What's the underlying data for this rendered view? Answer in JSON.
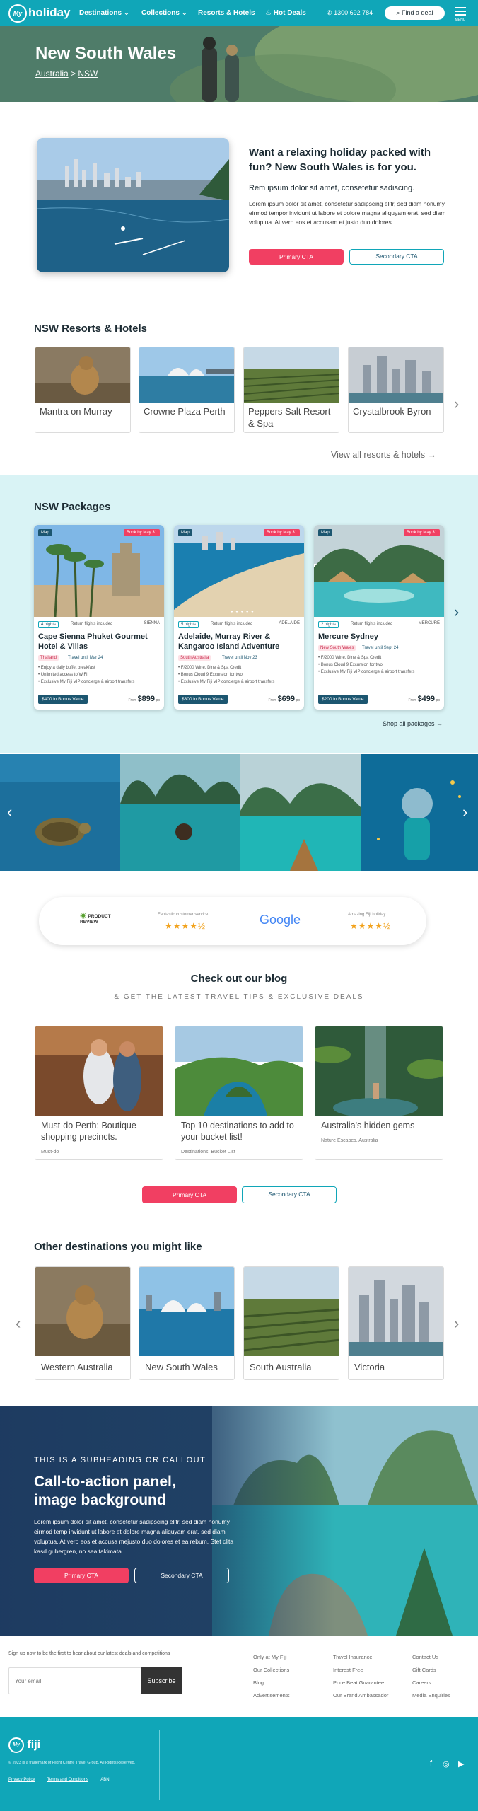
{
  "header": {
    "logo": "holiday",
    "logo_mark": "My",
    "nav": [
      "Destinations",
      "Collections",
      "Resorts & Hotels",
      "Hot Deals"
    ],
    "phone": "1300 692 784",
    "find_deal": "Find a deal",
    "menu_label": "MENU"
  },
  "hero": {
    "title": "New South Wales",
    "breadcrumb_parent": "Australia",
    "breadcrumb_sep": ">",
    "breadcrumb_current": "NSW"
  },
  "intro": {
    "heading": "Want a relaxing holiday packed with fun? New South Wales is for you.",
    "subheading": "Rem ipsum dolor sit amet, consetetur sadiscing.",
    "body": "Lorem ipsum dolor sit amet, consetetur sadipscing elitr, sed diam nonumy eirmod tempor invidunt ut labore et dolore magna aliquyam erat, sed diam voluptua. At vero eos et accusam et justo duo dolores.",
    "primary_cta": "Primary CTA",
    "secondary_cta": "Secondary CTA"
  },
  "resorts": {
    "title": "NSW Resorts & Hotels",
    "items": [
      {
        "name": "Mantra on Murray"
      },
      {
        "name": "Crowne Plaza Perth"
      },
      {
        "name": "Peppers Salt Resort & Spa"
      },
      {
        "name": "Crystalbrook Byron"
      }
    ],
    "view_all": "View all resorts & hotels →"
  },
  "packages": {
    "title": "NSW Packages",
    "items": [
      {
        "map": "Map",
        "ribbon": "Book by May 31",
        "nights": "4 nights",
        "returns": "Return flights included",
        "brand": "SIENNA",
        "name": "Cape Sienna Phuket Gourmet Hotel & Villas",
        "tag": "Thailand",
        "until": "Travel until Mar 24",
        "inclusions": [
          "Enjoy a daily buffet breakfast",
          "Unlimited access to WiFi",
          "Exclusive My Fiji VIP concierge & airport transfers"
        ],
        "bonus": "$400 in Bonus Value",
        "from": "From",
        "price": "$899",
        "pp": "pp"
      },
      {
        "map": "Map",
        "ribbon": "Book by May 31",
        "nights": "5 nights",
        "returns": "Return flights included",
        "brand": "ADELAIDE",
        "name": "Adelaide, Murray River & Kangaroo Island Adventure",
        "tag": "South Australia",
        "until": "Travel until Nov 23",
        "inclusions": [
          "F/2000 Wine, Dine & Spa Credit",
          "Bonus Cloud 9 Excursion for two",
          "Exclusive My Fiji VIP concierge & airport transfers"
        ],
        "bonus": "$300 in Bonus Value",
        "from": "From",
        "price": "$699",
        "pp": "pp"
      },
      {
        "map": "Map",
        "ribbon": "Book by May 31",
        "nights": "2 nights",
        "returns": "Return flights included",
        "brand": "MERCURE",
        "name": "Mercure Sydney",
        "tag": "New South Wales",
        "until": "Travel until Sept 24",
        "inclusions": [
          "F/2000 Wine, Dine & Spa Credit",
          "Bonus Cloud 9 Excursion for two",
          "Exclusive My Fiji VIP concierge & airport transfers"
        ],
        "bonus": "$200 in Bonus Value",
        "from": "From",
        "price": "$499",
        "pp": "pp"
      }
    ],
    "shop_all": "Shop all packages →"
  },
  "reviews": {
    "pr_name": "PRODUCT REVIEW",
    "pr_caption": "Fantastic customer service",
    "pr_rating": 4.5,
    "google_name": "Google",
    "google_caption": "Amazing Fiji holiday",
    "google_rating": 4.5
  },
  "blog": {
    "title": "Check out our blog",
    "subtitle": "& GET THE LATEST TRAVEL TIPS & EXCLUSIVE DEALS",
    "items": [
      {
        "title": "Must-do Perth: Boutique shopping precincts.",
        "meta": "Must-do"
      },
      {
        "title": "Top 10 destinations to add to your bucket list!",
        "meta": "Destinations, Bucket List"
      },
      {
        "title": "Australia's hidden gems",
        "meta": "Nature Escapes, Australia"
      }
    ],
    "primary_cta": "Primary CTA",
    "secondary_cta": "Secondary CTA"
  },
  "destinations": {
    "title": "Other destinations you might like",
    "items": [
      {
        "name": "Western Australia"
      },
      {
        "name": "New South Wales"
      },
      {
        "name": "South Australia"
      },
      {
        "name": "Victoria"
      }
    ]
  },
  "cta_panel": {
    "kicker": "THIS IS A SUBHEADING OR CALLOUT",
    "title": "Call-to-action panel, image background",
    "body": "Lorem ipsum dolor sit amet, consetetur sadipscing elitr, sed diam nonumy eirmod temp invidunt ut labore et dolore magna aliquyam erat, sed diam voluptua. At vero eos et accusa mejusto duo dolores et ea rebum. Stet clita kasd gubergren, no sea takimata.",
    "primary_cta": "Primary CTA",
    "secondary_cta": "Secondary CTA"
  },
  "footer": {
    "signup_text": "Sign up now to be the first to hear about our latest deals and competitions",
    "email_placeholder": "Your email",
    "subscribe": "Subscribe",
    "col1": [
      "Only at My Fiji",
      "Our Collections",
      "Blog",
      "Advertisements"
    ],
    "col2": [
      "Travel Insurance",
      "Interest Free",
      "Price Beat Guarantee",
      "Our Brand Ambassador"
    ],
    "col3": [
      "Contact Us",
      "Gift Cards",
      "Careers",
      "Media Enquiries"
    ],
    "logo": "fiji",
    "logo_mark": "My",
    "copyright": "© 2023 is a trademark of Flight Centre Travel Group. All Rights Reserved.",
    "legal": [
      "Privacy Policy",
      "Terms and Conditions",
      "ABN"
    ],
    "social": [
      "f",
      "◎",
      "▶"
    ]
  }
}
